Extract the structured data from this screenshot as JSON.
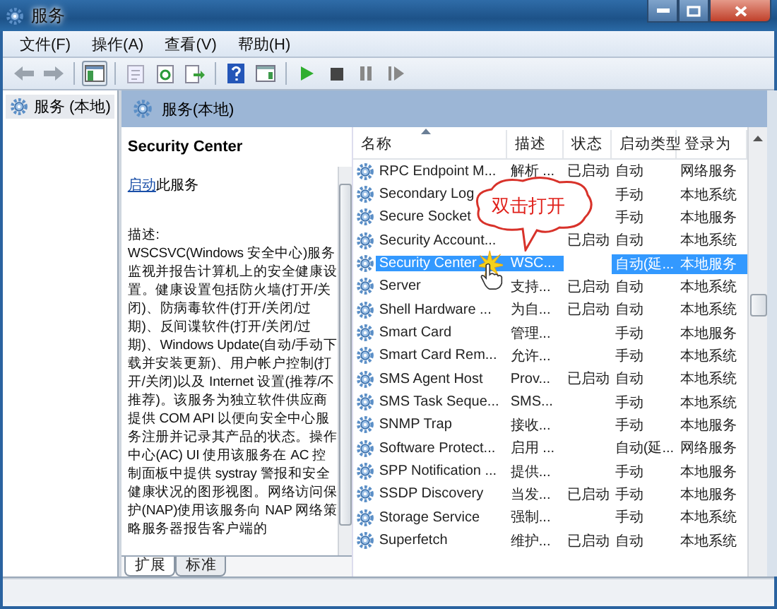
{
  "window": {
    "title": "服务"
  },
  "menu": [
    "文件(F)",
    "操作(A)",
    "查看(V)",
    "帮助(H)"
  ],
  "tree": {
    "items": [
      {
        "label": "服务 (本地)",
        "selected": true
      }
    ]
  },
  "panel_header": "服务(本地)",
  "detail": {
    "title": "Security Center",
    "action_link": "启动",
    "action_text": "此服务",
    "description_label": "描述:",
    "description": "WSCSVC(Windows 安全中心)服务监视并报告计算机上的安全健康设置。健康设置包括防火墙(打开/关闭)、防病毒软件(打开/关闭/过期)、反间谍软件(打开/关闭/过期)、Windows Update(自动/手动下载并安装更新)、用户帐户控制(打开/关闭)以及 Internet 设置(推荐/不推荐)。该服务为独立软件供应商提供 COM API 以便向安全中心服务注册并记录其产品的状态。操作中心(AC) UI 使用该服务在 AC 控制面板中提供 systray 警报和安全健康状况的图形视图。网络访问保护(NAP)使用该服务向 NAP 网络策略服务器报告客户端的"
  },
  "columns": [
    "名称",
    "描述",
    "状态",
    "启动类型",
    "登录为"
  ],
  "services": [
    {
      "name": "RPC Endpoint M...",
      "description": "解析 ...",
      "status": "已启动",
      "startup": "自动",
      "logon": "网络服务",
      "selected": false
    },
    {
      "name": "Secondary Log",
      "startup": "手动",
      "logon": "本地系统",
      "selected": false
    },
    {
      "name": "Secure Socket",
      "startup": "手动",
      "logon": "本地服务",
      "selected": false
    },
    {
      "name": "Security Account...",
      "status": "已启动",
      "startup": "自动",
      "logon": "本地系统",
      "selected": false
    },
    {
      "name": "Security Center",
      "description": "WSC...",
      "startup": "自动(延...",
      "logon": "本地服务",
      "selected": true
    },
    {
      "name": "Server",
      "description": "支持...",
      "status": "已启动",
      "startup": "自动",
      "logon": "本地系统",
      "selected": false
    },
    {
      "name": "Shell Hardware ...",
      "description": "为自...",
      "status": "已启动",
      "startup": "自动",
      "logon": "本地系统",
      "selected": false
    },
    {
      "name": "Smart Card",
      "description": "管理...",
      "startup": "手动",
      "logon": "本地服务",
      "selected": false
    },
    {
      "name": "Smart Card Rem...",
      "description": "允许...",
      "startup": "手动",
      "logon": "本地系统",
      "selected": false
    },
    {
      "name": "SMS Agent Host",
      "description": "Prov...",
      "status": "已启动",
      "startup": "自动",
      "logon": "本地系统",
      "selected": false
    },
    {
      "name": "SMS Task Seque...",
      "description": "SMS...",
      "startup": "手动",
      "logon": "本地系统",
      "selected": false
    },
    {
      "name": "SNMP Trap",
      "description": "接收...",
      "startup": "手动",
      "logon": "本地服务",
      "selected": false
    },
    {
      "name": "Software Protect...",
      "description": "启用 ...",
      "startup": "自动(延...",
      "logon": "网络服务",
      "selected": false
    },
    {
      "name": "SPP Notification ...",
      "description": "提供...",
      "startup": "手动",
      "logon": "本地服务",
      "selected": false
    },
    {
      "name": "SSDP Discovery",
      "description": "当发...",
      "status": "已启动",
      "startup": "手动",
      "logon": "本地服务",
      "selected": false
    },
    {
      "name": "Storage Service",
      "description": "强制...",
      "startup": "手动",
      "logon": "本地系统",
      "selected": false
    },
    {
      "name": "Superfetch",
      "description": "维护...",
      "status": "已启动",
      "startup": "自动",
      "logon": "本地系统",
      "selected": false
    }
  ],
  "view_tabs": [
    {
      "label": "扩展",
      "selected": true
    },
    {
      "label": "标准",
      "selected": false
    }
  ],
  "callout": {
    "text": "双击打开"
  }
}
